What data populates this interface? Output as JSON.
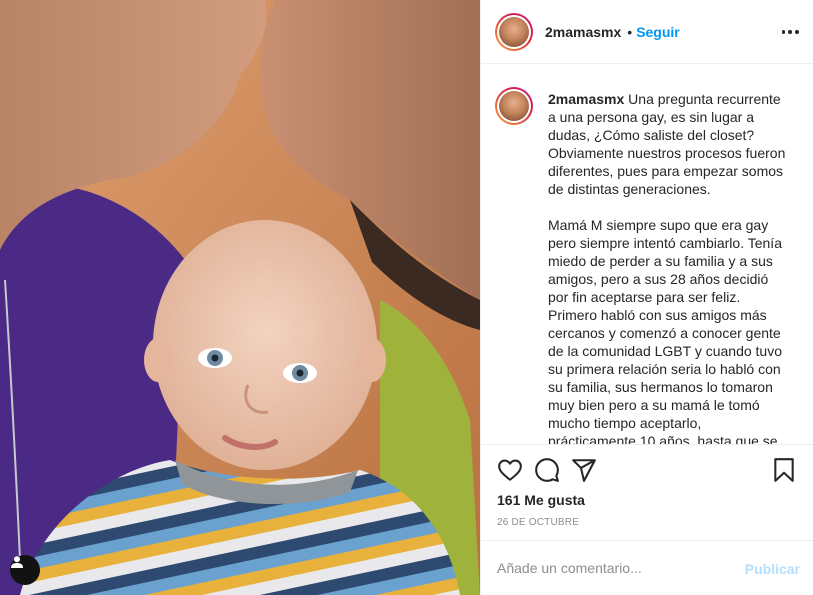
{
  "post": {
    "username": "2mamasmx",
    "separator": "•",
    "follow_label": "Seguir",
    "more_icon": "more-options-icon",
    "caption_text": "Una pregunta recurrente a una persona gay, es sin lugar a dudas, ¿Cómo saliste del closet? Obviamente nuestros procesos fueron diferentes, pues para empezar somos de distintas generaciones.\n\nMamá M siempre supo que era gay pero siempre intentó cambiarlo. Tenía miedo de perder a su familia y a sus amigos, pero a sus 28 años decidió por fin aceptarse para ser feliz. Primero habló con sus amigos más cercanos y comenzó a conocer gente de la comunidad LGBT y cuando tuvo su primera relación seria lo habló con su familia, sus hermanos lo tomaron muy bien pero a su mamá le tomó mucho tiempo aceptarlo, prácticamente 10 años, hasta que se",
    "likes_text": "161 Me gusta",
    "date_text": "26 DE OCTUBRE",
    "comment_placeholder": "Añade un comentario...",
    "publish_label": "Publicar",
    "icons": {
      "like": "heart-icon",
      "comment": "comment-icon",
      "share": "paper-plane-icon",
      "save": "bookmark-icon",
      "tag": "user-tag-icon"
    }
  },
  "colors": {
    "accent_blue": "#0095f6",
    "publish_disabled": "#b2dffc",
    "text": "#262626",
    "muted": "#8e8e8e"
  }
}
